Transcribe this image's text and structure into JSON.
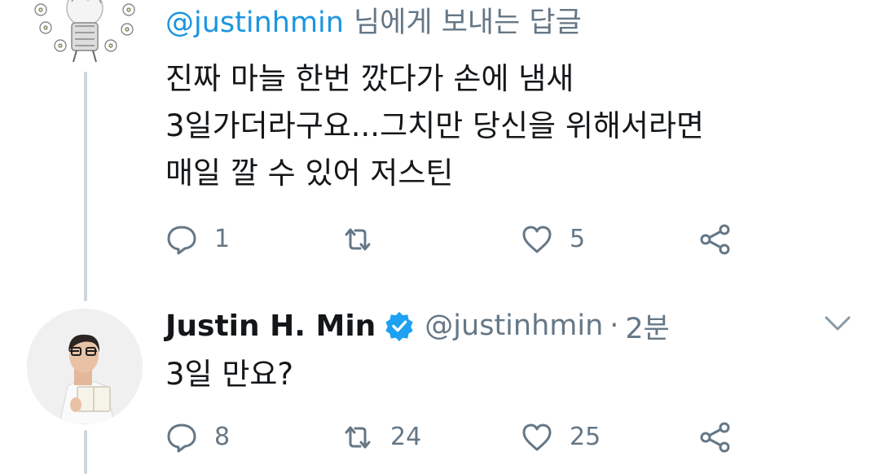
{
  "tweet1": {
    "reply_mention": "@justinhmin",
    "reply_suffix": "님에게 보내는 답글",
    "lines": [
      "진짜 마늘 한번 깠다가 손에 냄새",
      "3일가더라구요...그치만 당신을 위해서라면",
      "매일 깔 수 있어 저스틴"
    ],
    "actions": {
      "reply_count": "1",
      "retweet_count": "",
      "like_count": "5"
    }
  },
  "tweet2": {
    "name": "Justin H. Min",
    "handle": "@justinhmin",
    "separator": "·",
    "time": "2분",
    "text": "3일 만요?",
    "actions": {
      "reply_count": "8",
      "retweet_count": "24",
      "like_count": "25"
    }
  },
  "colors": {
    "text": "#14171a",
    "secondary": "#657786",
    "link": "#1b95e0",
    "verified": "#1da1f2",
    "thread_line": "#ccd6dd"
  }
}
